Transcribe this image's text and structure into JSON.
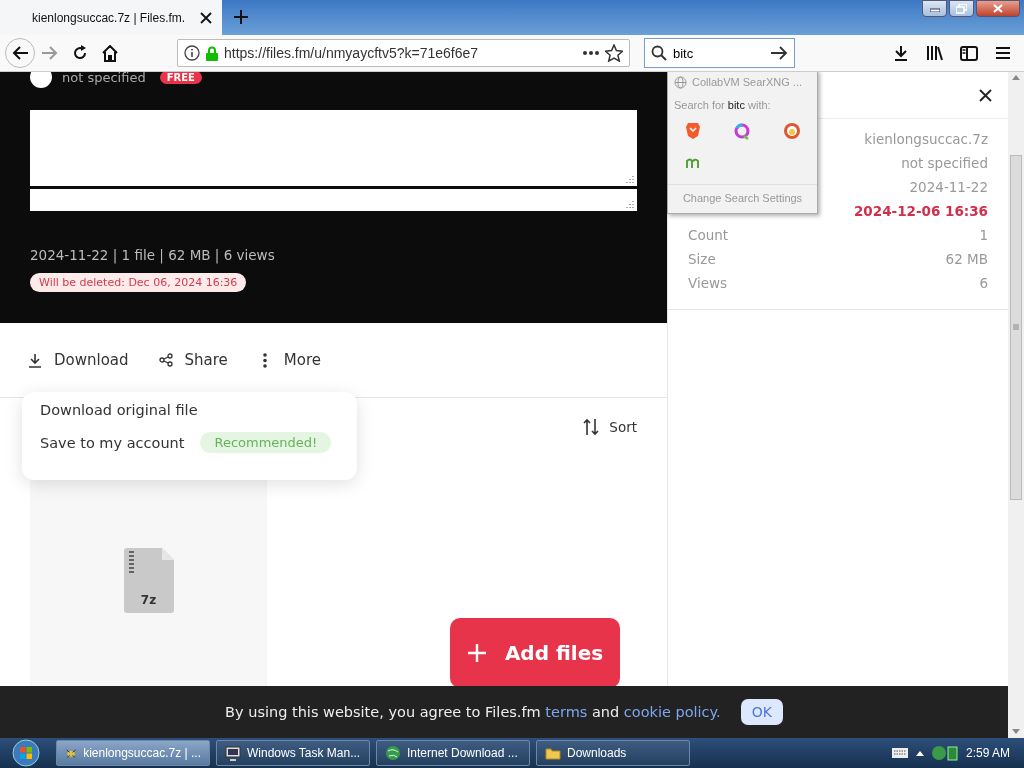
{
  "browser": {
    "tab_title": "kienlongsuccac.7z | Files.fm.",
    "url": "https://files.fm/u/nmyaycftv5?k=71e6f6e7",
    "search_query": "bitc"
  },
  "search_popup": {
    "engine": "CollabVM SearXNG ...",
    "prompt": "Search for **bitc** with:",
    "settings": "Change Search Settings"
  },
  "upload": {
    "owner": "not specified",
    "badge": "FREE",
    "summary": "2024-11-22 | 1 file | 62 MB | 6 views",
    "deletion_notice": "Will be deleted: Dec 06, 2024 16:36"
  },
  "actions": [
    {
      "label": "Download"
    },
    {
      "label": "Share"
    },
    {
      "label": "More"
    }
  ],
  "download_menu": [
    {
      "label": "Download original file"
    },
    {
      "label": "Save to my account",
      "badge": "Recommended!"
    }
  ],
  "sort": "Sort",
  "file": {
    "extension": "7z"
  },
  "add_files": "Add files",
  "details": [
    {
      "value": "kienlongsuccac.7z",
      "kind": "plain"
    },
    {
      "value": "not specified",
      "kind": "plain"
    },
    {
      "value": "2024-11-22",
      "kind": "plain"
    },
    {
      "value": "2024-12-06 16:36",
      "kind": "warning"
    },
    {
      "label": "Count",
      "value": "1",
      "kind": "plain"
    },
    {
      "label": "Size",
      "value": "62 MB",
      "kind": "plain"
    },
    {
      "label": "Views",
      "value": "6",
      "kind": "plain"
    }
  ],
  "cookie_notice": {
    "text_before": "By using this website, you agree to Files.fm",
    "link_terms": "terms",
    "text_between": "and",
    "link_policy": "cookie policy.",
    "button": "OK"
  },
  "taskbar": {
    "tasks": [
      {
        "label": "kienlongsuccac.7z | ...",
        "selected": true
      },
      {
        "label": "Windows Task Man...",
        "selected": false
      },
      {
        "label": "Internet Download ...",
        "selected": false
      },
      {
        "label": "Downloads",
        "selected": false
      }
    ],
    "clock": "2:59 AM"
  }
}
